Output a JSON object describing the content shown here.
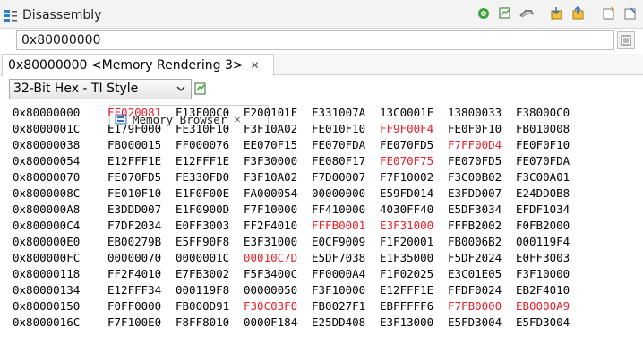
{
  "tabs": [
    {
      "label": "Disassembly",
      "active": false,
      "icon": "disassembly-icon"
    },
    {
      "label": "Memory Browser",
      "active": true,
      "icon": "memory-icon",
      "close": "✕"
    }
  ],
  "toolbar": {
    "icons": [
      "run-icon",
      "new-rendering-icon",
      "link-icon",
      "import-icon",
      "export-icon",
      "new-window-icon",
      "pin-icon"
    ]
  },
  "address": {
    "value": "0x80000000"
  },
  "rendering_tab": {
    "label": "0x80000000 <Memory Rendering 3>",
    "close": "✕"
  },
  "format": {
    "selected": "32-Bit Hex - TI Style"
  },
  "colors": {
    "changed": "#e8202a",
    "normal": "#000000"
  },
  "memory": {
    "rows": [
      {
        "addr": "0x80000000",
        "cells": [
          "FF020081",
          "F13F00C0",
          "E200101F",
          "F331007A",
          "13C0001F",
          "13800033",
          "F38000C0"
        ],
        "changed": [
          0
        ]
      },
      {
        "addr": "0x8000001C",
        "cells": [
          "E179F000",
          "FE310F10",
          "F3F10A02",
          "FE010F10",
          "FF9F00F4",
          "FE0F0F10",
          "FB010008"
        ],
        "changed": [
          4
        ]
      },
      {
        "addr": "0x80000038",
        "cells": [
          "FB000015",
          "FF000076",
          "EE070F15",
          "FE070FDA",
          "FE070FD5",
          "F7FF00D4",
          "FE0F0F10"
        ],
        "changed": [
          5
        ]
      },
      {
        "addr": "0x80000054",
        "cells": [
          "E12FFF1E",
          "E12FFF1E",
          "F3F30000",
          "FE080F17",
          "FE070F75",
          "FE070FD5",
          "FE070FDA"
        ],
        "changed": [
          4
        ]
      },
      {
        "addr": "0x80000070",
        "cells": [
          "FE070FD5",
          "FE330FD0",
          "F3F10A02",
          "F7D00007",
          "F7F10002",
          "F3C00B02",
          "F3C00A01"
        ],
        "changed": []
      },
      {
        "addr": "0x8000008C",
        "cells": [
          "FE010F10",
          "E1F0F00E",
          "FA000054",
          "00000000",
          "E59FD014",
          "E3FDD007",
          "E24DD0B8"
        ],
        "changed": []
      },
      {
        "addr": "0x800000A8",
        "cells": [
          "E3DDD007",
          "E1F0900D",
          "F7F10000",
          "FF410000",
          "4030FF40",
          "E5DF3034",
          "EFDF1034"
        ],
        "changed": []
      },
      {
        "addr": "0x800000C4",
        "cells": [
          "F7DF2034",
          "E0FF3003",
          "FF2F4010",
          "FFFB0001",
          "E3F31000",
          "FFFB2002",
          "F0FB2000"
        ],
        "changed": [
          3,
          4
        ]
      },
      {
        "addr": "0x800000E0",
        "cells": [
          "EB00279B",
          "E5FF90F8",
          "E3F31000",
          "E0CF9009",
          "F1F20001",
          "FB0006B2",
          "000119F4"
        ],
        "changed": []
      },
      {
        "addr": "0x800000FC",
        "cells": [
          "00000070",
          "0000001C",
          "00010C7D",
          "E5DF7038",
          "E1F35000",
          "F5DF2024",
          "E0FF3003"
        ],
        "changed": [
          2
        ]
      },
      {
        "addr": "0x80000118",
        "cells": [
          "FF2F4010",
          "E7FB3002",
          "F5F3400C",
          "FF0000A4",
          "F1F02025",
          "E3C01E05",
          "F3F10000"
        ],
        "changed": []
      },
      {
        "addr": "0x80000134",
        "cells": [
          "E12FFF34",
          "000119F8",
          "00000050",
          "F3F10000",
          "E12FFF1E",
          "FFDF0024",
          "EB2F4010"
        ],
        "changed": []
      },
      {
        "addr": "0x80000150",
        "cells": [
          "F0FF0000",
          "FB000D91",
          "F30C03F0",
          "FB0027F1",
          "EBFFFFF6",
          "F7FB0000",
          "EB0000A9"
        ],
        "changed": [
          2,
          5,
          6
        ]
      },
      {
        "addr": "0x8000016C",
        "cells": [
          "F7F100E0",
          "F8FF8010",
          "0000F184",
          "E25DD408",
          "E3F13000",
          "E5FD3004",
          "E5FD3004"
        ],
        "changed": []
      }
    ]
  }
}
